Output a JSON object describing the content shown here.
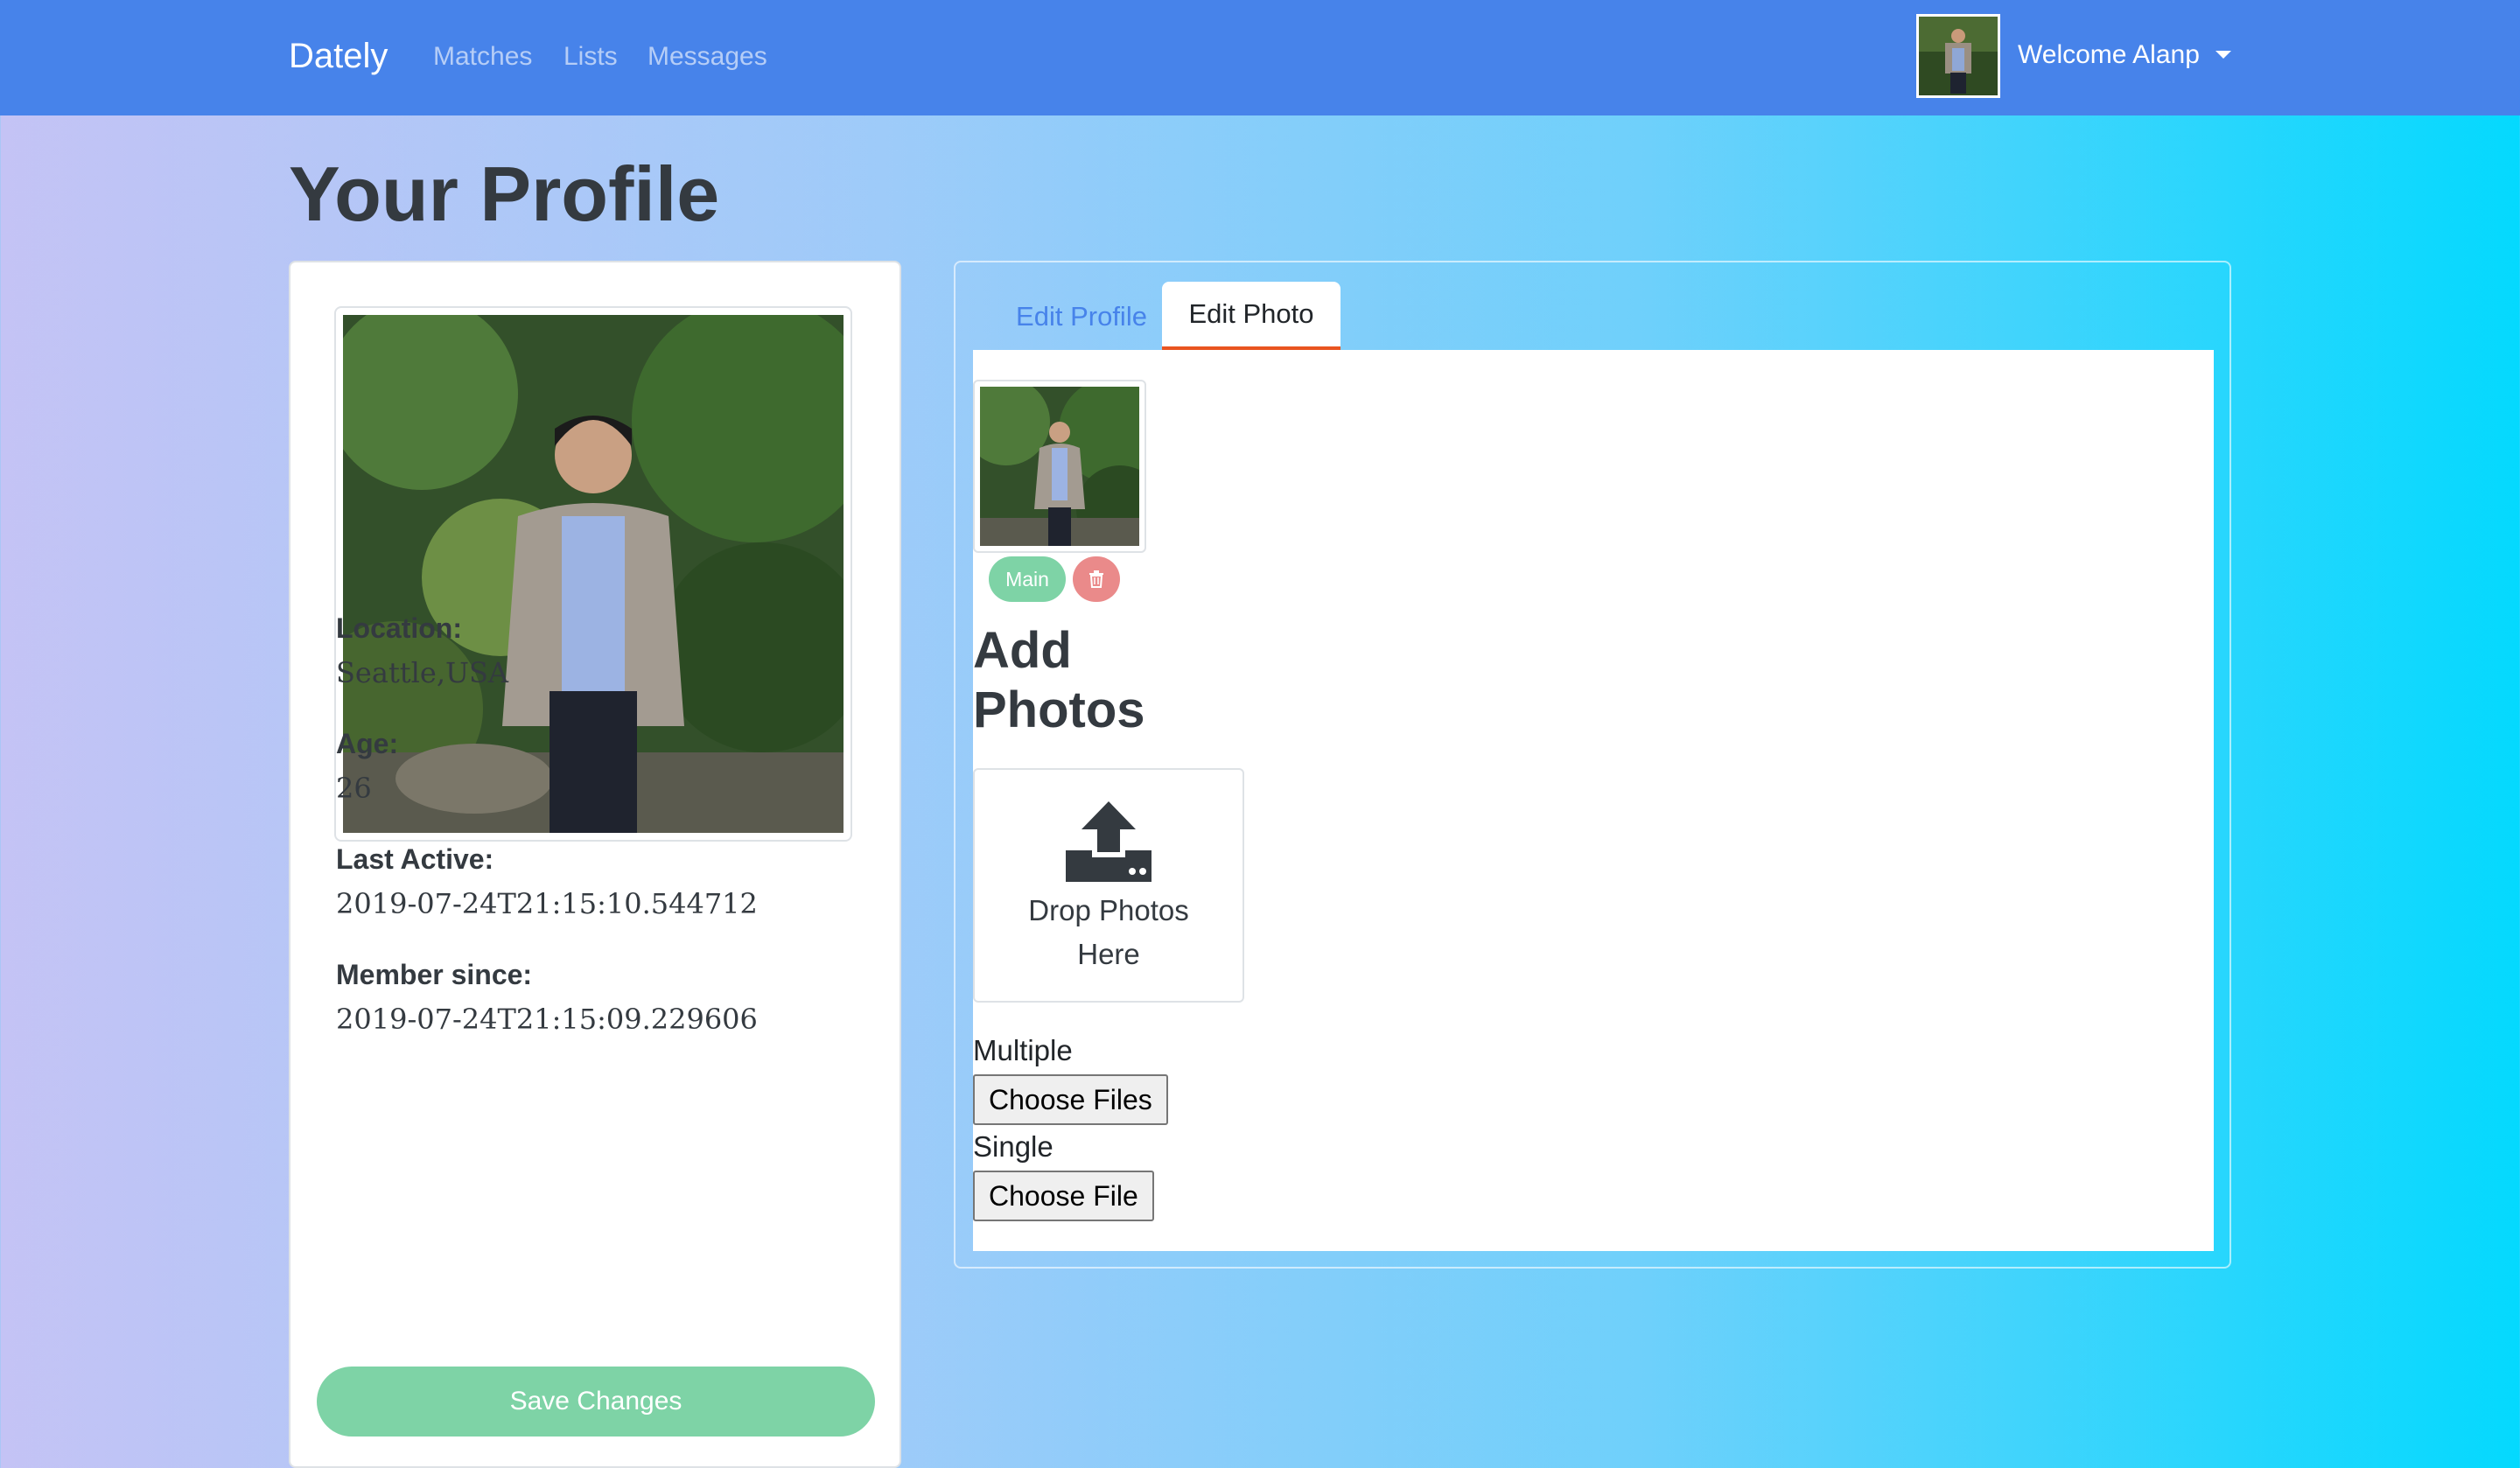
{
  "nav": {
    "brand": "Dately",
    "links": [
      "Matches",
      "Lists",
      "Messages"
    ],
    "welcome": "Welcome Alanp"
  },
  "page": {
    "title": "Your Profile"
  },
  "profile": {
    "fields": [
      {
        "label": "Location:",
        "value": "Seattle,USA"
      },
      {
        "label": "Age:",
        "value": "26"
      },
      {
        "label": "Last Active:",
        "value": "2019-07-24T21:15:10.544712"
      },
      {
        "label": "Member since:",
        "value": "2019-07-24T21:15:09.229606"
      }
    ],
    "save_label": "Save Changes"
  },
  "tabs": [
    {
      "label": "Edit Profile",
      "active": false
    },
    {
      "label": "Edit Photo",
      "active": true
    }
  ],
  "photos": {
    "main_label": "Main",
    "add_title": "Add Photos",
    "drop_text_line1": "Drop Photos",
    "drop_text_line2": "Here",
    "multiple_label": "Multiple",
    "multiple_button": "Choose Files",
    "single_label": "Single",
    "single_button": "Choose File"
  },
  "colors": {
    "navbar": "#4783ea",
    "success": "#7ed3a6",
    "danger": "#ea8a8a",
    "tab_accent": "#e95420"
  },
  "icons": [
    "caret-down-icon",
    "trash-icon",
    "upload-icon"
  ]
}
